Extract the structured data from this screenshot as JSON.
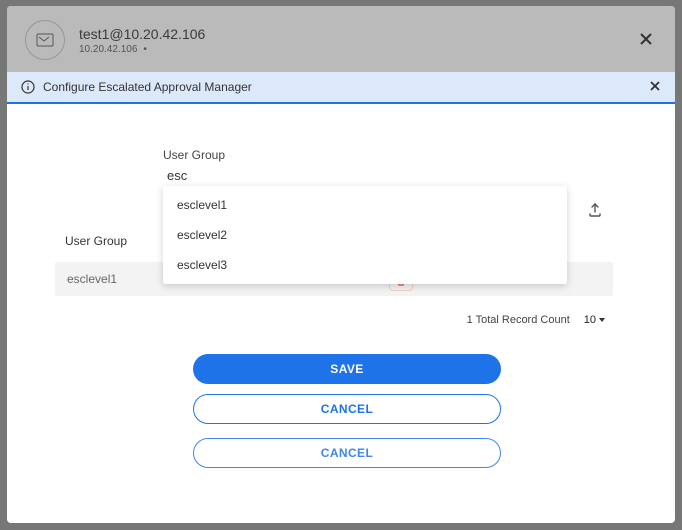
{
  "device": {
    "title": "test1@10.20.42.106",
    "subtitle_ip": "10.20.42.106"
  },
  "banner": {
    "title": "Configure Escalated Approval Manager"
  },
  "field": {
    "label": "User Group",
    "value": "esc"
  },
  "dropdown": {
    "items": [
      "esclevel1",
      "esclevel2",
      "esclevel3"
    ]
  },
  "table": {
    "column_header": "User Group",
    "rows": [
      {
        "name": "esclevel1"
      }
    ],
    "record_count_text": "1 Total Record Count",
    "page_size": "10"
  },
  "buttons": {
    "save": "SAVE",
    "cancel": "CANCEL",
    "cancel_behind": "CANCEL"
  }
}
